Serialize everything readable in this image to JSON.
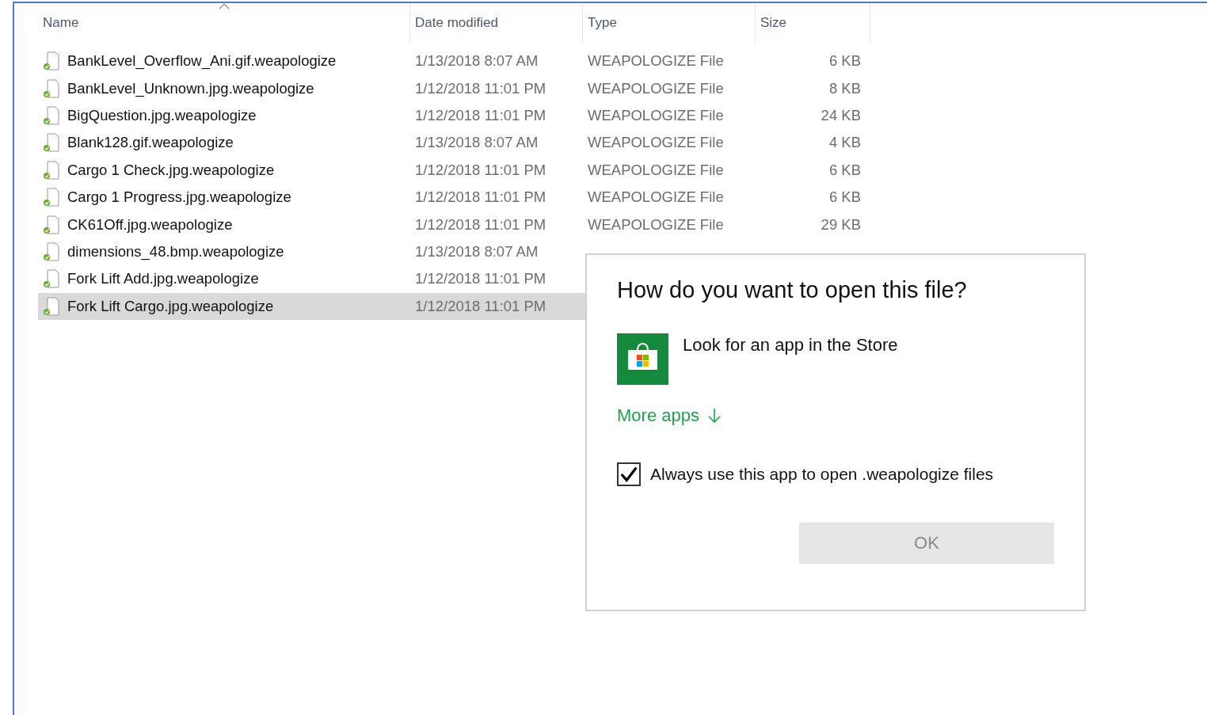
{
  "columns": [
    {
      "label": "Name",
      "sorted": true
    },
    {
      "label": "Date modified",
      "sorted": false
    },
    {
      "label": "Type",
      "sorted": false
    },
    {
      "label": "Size",
      "sorted": false
    }
  ],
  "files": [
    {
      "name": "BankLevel_Overflow_Ani.gif.weapologize",
      "date": "1/13/2018 8:07 AM",
      "type": "WEAPOLOGIZE File",
      "size": "6 KB",
      "selected": false
    },
    {
      "name": "BankLevel_Unknown.jpg.weapologize",
      "date": "1/12/2018 11:01 PM",
      "type": "WEAPOLOGIZE File",
      "size": "8 KB",
      "selected": false
    },
    {
      "name": "BigQuestion.jpg.weapologize",
      "date": "1/12/2018 11:01 PM",
      "type": "WEAPOLOGIZE File",
      "size": "24 KB",
      "selected": false
    },
    {
      "name": "Blank128.gif.weapologize",
      "date": "1/13/2018 8:07 AM",
      "type": "WEAPOLOGIZE File",
      "size": "4 KB",
      "selected": false
    },
    {
      "name": "Cargo 1 Check.jpg.weapologize",
      "date": "1/12/2018 11:01 PM",
      "type": "WEAPOLOGIZE File",
      "size": "6 KB",
      "selected": false
    },
    {
      "name": "Cargo 1 Progress.jpg.weapologize",
      "date": "1/12/2018 11:01 PM",
      "type": "WEAPOLOGIZE File",
      "size": "6 KB",
      "selected": false
    },
    {
      "name": "CK61Off.jpg.weapologize",
      "date": "1/12/2018 11:01 PM",
      "type": "WEAPOLOGIZE File",
      "size": "29 KB",
      "selected": false
    },
    {
      "name": "dimensions_48.bmp.weapologize",
      "date": "1/13/2018 8:07 AM",
      "selected": false
    },
    {
      "name": "Fork Lift Add.jpg.weapologize",
      "date": "1/12/2018 11:01 PM",
      "selected": false
    },
    {
      "name": "Fork Lift Cargo.jpg.weapologize",
      "date": "1/12/2018 11:01 PM",
      "selected": true
    }
  ],
  "dialog": {
    "title": "How do you want to open this file?",
    "app": "Look for an app in the Store",
    "more": "More apps",
    "always": {
      "label": "Always use this app to open .weapologize files",
      "checked": true
    },
    "ok": {
      "label": "OK",
      "disabled": true
    }
  }
}
